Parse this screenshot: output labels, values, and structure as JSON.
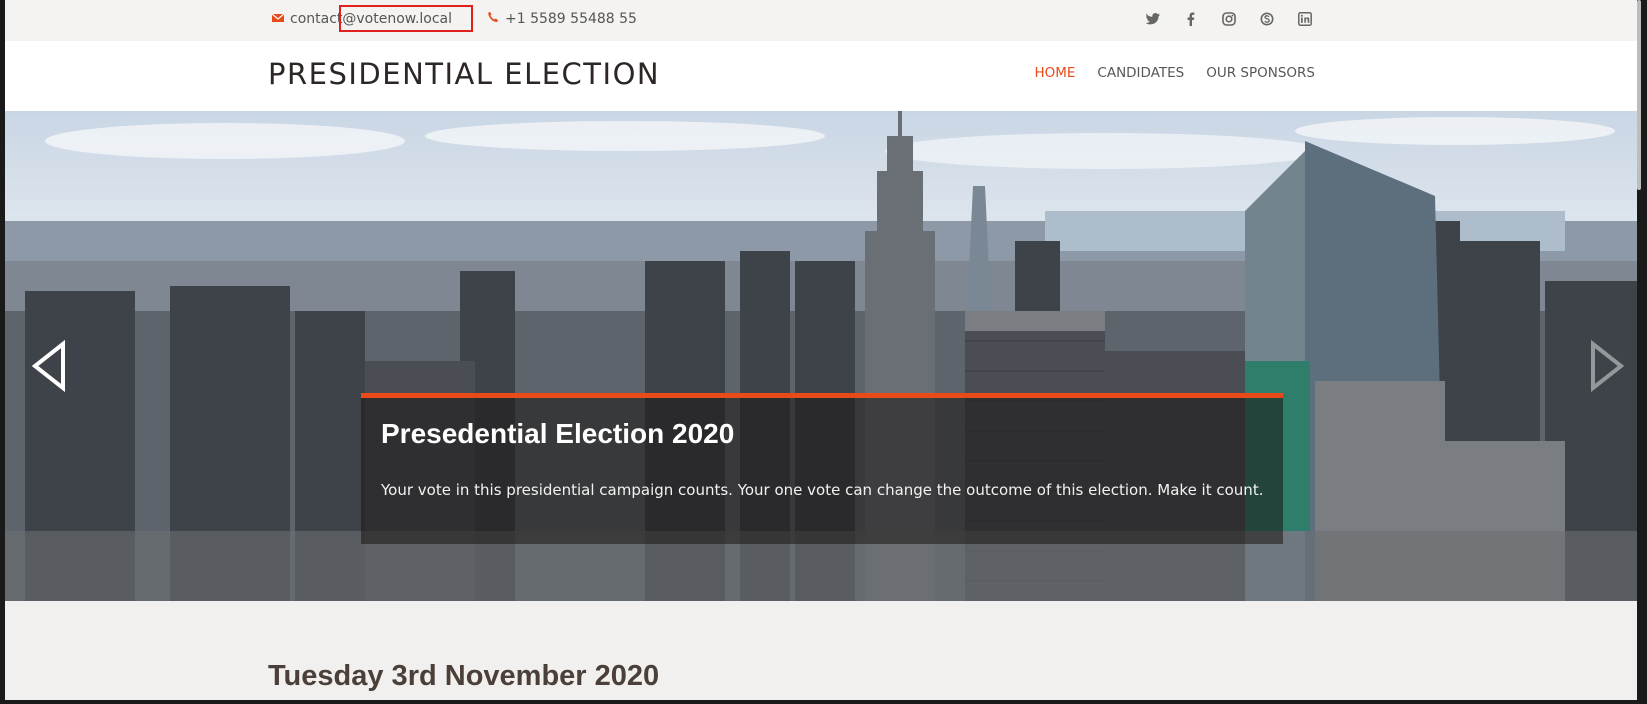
{
  "topbar": {
    "email": "contact@votenow.local",
    "phone": "+1 5589 55488 55",
    "social": [
      "twitter-icon",
      "facebook-icon",
      "instagram-icon",
      "skype-icon",
      "linkedin-icon"
    ]
  },
  "header": {
    "title": "PRESIDENTIAL ELECTION",
    "nav": [
      "HOME",
      "CANDIDATES",
      "OUR SPONSORS"
    ],
    "active_nav": "HOME"
  },
  "hero": {
    "title": "Presedential Election 2020",
    "text": "Your vote in this presidential campaign counts. Your one vote can change the outcome of this election. Make it count."
  },
  "section": {
    "date": "Tuesday 3rd November 2020"
  },
  "colors": {
    "accent": "#e84b19",
    "highlight": "#e0201f"
  }
}
